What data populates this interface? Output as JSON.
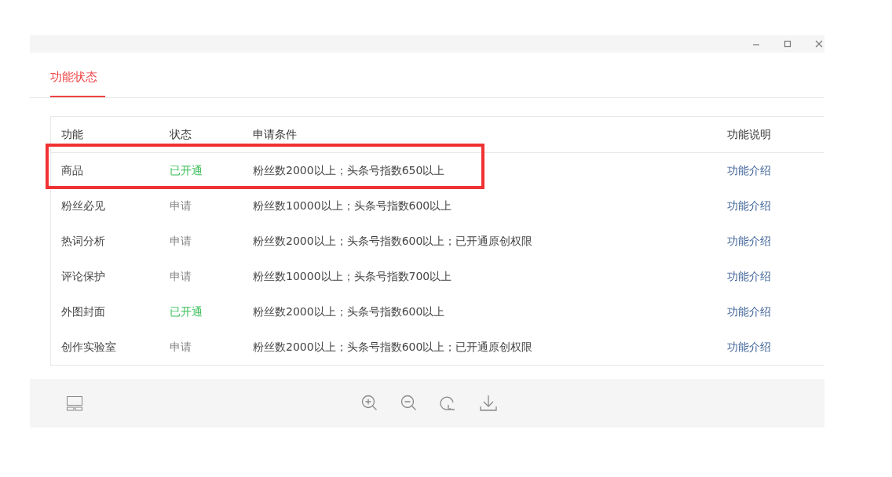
{
  "tabs": [
    {
      "label": "功能状态",
      "selected": true
    }
  ],
  "table": {
    "columns": [
      "功能",
      "状态",
      "申请条件",
      "功能说明"
    ],
    "rows": [
      {
        "feature": "商品",
        "status": "已开通",
        "enabled": true,
        "condition": "粉丝数2000以上；头条号指数650以上",
        "link": "功能介绍",
        "highlighted": true
      },
      {
        "feature": "粉丝必见",
        "status": "申请",
        "enabled": false,
        "condition": "粉丝数10000以上；头条号指数600以上",
        "link": "功能介绍",
        "highlighted": false
      },
      {
        "feature": "热词分析",
        "status": "申请",
        "enabled": false,
        "condition": "粉丝数2000以上；头条号指数600以上；已开通原创权限",
        "link": "功能介绍",
        "highlighted": false
      },
      {
        "feature": "评论保护",
        "status": "申请",
        "enabled": false,
        "condition": "粉丝数10000以上；头条号指数700以上",
        "link": "功能介绍",
        "highlighted": false
      },
      {
        "feature": "外图封面",
        "status": "已开通",
        "enabled": true,
        "condition": "粉丝数2000以上；头条号指数600以上",
        "link": "功能介绍",
        "highlighted": false
      },
      {
        "feature": "创作实验室",
        "status": "申请",
        "enabled": false,
        "condition": "粉丝数2000以上；头条号指数600以上；已开通原创权限",
        "link": "功能介绍",
        "highlighted": false
      }
    ]
  }
}
